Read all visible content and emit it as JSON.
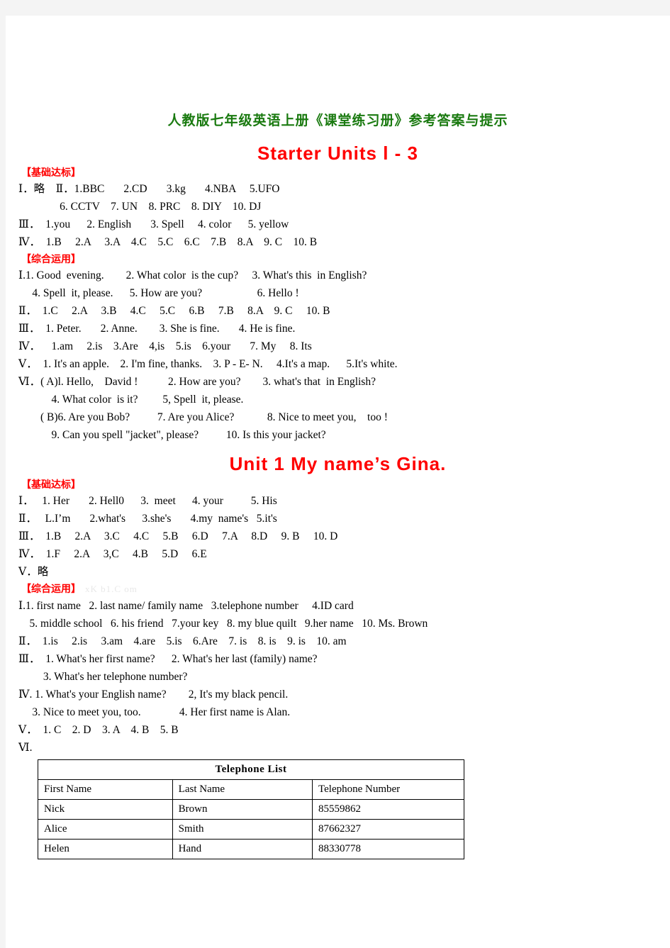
{
  "document": {
    "title": "人教版七年级英语上册《课堂练习册》参考答案与提示",
    "watermark": "xK b1.C om"
  },
  "units": [
    {
      "heading": "Starter  Units l - 3",
      "sections": [
        {
          "label": "【基础达标】",
          "lines": [
            "Ⅰ．略    Ⅱ．1.BBC       2.CD       3.kg       4.NBA     5.UFO",
            "               6. CCTV    7. UN    8. PRC    8. DIY    10. DJ",
            "Ⅲ．  1.you      2. English       3. Spell     4. color      5. yellow",
            "Ⅳ．  1.B     2.A     3.A    4.C    5.C    6.C    7.B    8.A    9. C    10. B"
          ]
        },
        {
          "label": "【综合运用】",
          "lines": [
            "Ⅰ.1. Good  evening.        2. What color  is the cup?     3. What's this  in English?",
            "     4. Spell  it, please.      5. How are you?                    6. Hello !",
            "Ⅱ．  1.C     2.A     3.B     4.C     5.C     6.B     7.B     8.A    9. C     10. B",
            "Ⅲ．  1. Peter.       2. Anne.        3. She is fine.       4. He is fine.",
            "Ⅳ．    1.am     2.is    3.Are    4,is    5.is    6.your       7. My     8. Its",
            "Ⅴ．  1. It's an apple.    2. I'm fine, thanks.    3. P - E- N.     4.It's a map.      5.It's white.",
            "Ⅵ．( A)l. Hello,    David !           2. How are you?        3. what's that  in English?",
            "            4. What color  is it?         5, Spell  it, please.",
            "        ( B)6. Are you Bob?          7. Are you Alice?            8. Nice to meet you,    too !",
            "            9. Can you spell \"jacket\", please?          10. Is this your jacket?"
          ]
        }
      ]
    },
    {
      "heading": "Unit  1    My  name’s  Gina.",
      "sections": [
        {
          "label": "【基础达标】",
          "lines": [
            "Ⅰ．   1. Her       2. Hell0      3.  meet      4. your          5. His",
            "Ⅱ．   L.I’m       2.what's      3.she's       4.my  name's   5.it's",
            "Ⅲ．  1.B     2.A     3.C     4.C     5.B     6.D     7.A     8.D     9. B     10. D",
            "Ⅳ．  1.F     2.A     3,C     4.B     5.D     6.E",
            "Ⅴ．略"
          ]
        },
        {
          "label": "【综合运用】",
          "watermark": "xK b1.C om",
          "lines": [
            "Ⅰ.1. first name   2. last name/ family name   3.telephone number     4.ID card",
            "    5. middle school   6. his friend   7.your key   8. my blue quilt   9.her name   10. Ms. Brown",
            "Ⅱ．  1.is     2.is     3.am    4.are    5.is    6.Are    7. is    8. is    9. is    10. am",
            "Ⅲ．  1. What's her first name?      2. What's her last (family) name?",
            "         3. What's her telephone number?",
            "Ⅳ. 1. What's your English name?        2, It's my black pencil.",
            "     3. Nice to meet you, too.              4. Her first name is Alan.",
            "Ⅴ．  1. C    2. D    3. A    4. B    5. B",
            "Ⅵ."
          ]
        }
      ]
    }
  ],
  "telephone_table": {
    "caption": "Telephone  List",
    "headers": [
      "First  Name",
      "Last  Name",
      "Telephone  Number"
    ],
    "rows": [
      [
        "Nick",
        "Brown",
        "85559862"
      ],
      [
        "Alice",
        "Smith",
        "87662327"
      ],
      [
        "Helen",
        "Hand",
        "88330778"
      ]
    ]
  },
  "colors": {
    "title_green": "#1a7a10",
    "heading_red": "#ff0000",
    "text_black": "#000000"
  }
}
